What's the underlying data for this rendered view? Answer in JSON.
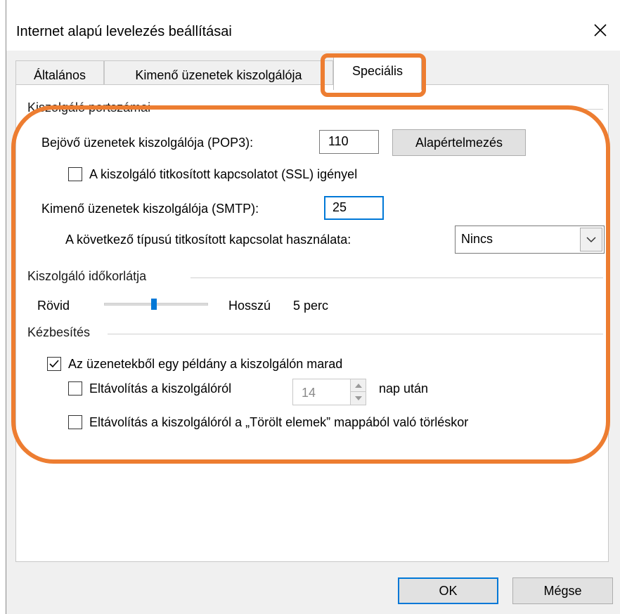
{
  "window": {
    "title": "Internet alapú levelezés beállításai"
  },
  "tabs": [
    {
      "label": "Általános"
    },
    {
      "label": "Kimenő üzenetek kiszolgálója"
    },
    {
      "label": "Speciális"
    }
  ],
  "ports": {
    "group_label": "Kiszolgáló portszámai",
    "incoming_label": "Bejövő üzenetek kiszolgálója (POP3):",
    "incoming_value": "110",
    "default_button": "Alapértelmezés",
    "ssl_label": "A kiszolgáló titkosított kapcsolatot (SSL) igényel",
    "ssl_checked": false,
    "outgoing_label": "Kimenő üzenetek kiszolgálója (SMTP):",
    "outgoing_value": "25",
    "encryption_label": "A következő típusú titkosított kapcsolat használata:",
    "encryption_value": "Nincs"
  },
  "timeout": {
    "group_label": "Kiszolgáló időkorlátja",
    "short_label": "Rövid",
    "long_label": "Hosszú",
    "value_label": "5 perc",
    "slider_fraction": 0.48
  },
  "delivery": {
    "group_label": "Kézbesítés",
    "leave_copy_label": "Az üzenetekből egy példány a kiszolgálón marad",
    "leave_copy_checked": true,
    "remove_after_label": "Eltávolítás a kiszolgálóról",
    "remove_after_checked": false,
    "remove_after_days": "14",
    "days_suffix": "nap után",
    "remove_deleted_label": "Eltávolítás a kiszolgálóról a „Törölt elemek” mappából való törléskor",
    "remove_deleted_checked": false
  },
  "footer": {
    "ok_label": "OK",
    "cancel_label": "Mégse"
  },
  "colors": {
    "highlight": "#ed7d31",
    "accent": "#0078d7"
  }
}
